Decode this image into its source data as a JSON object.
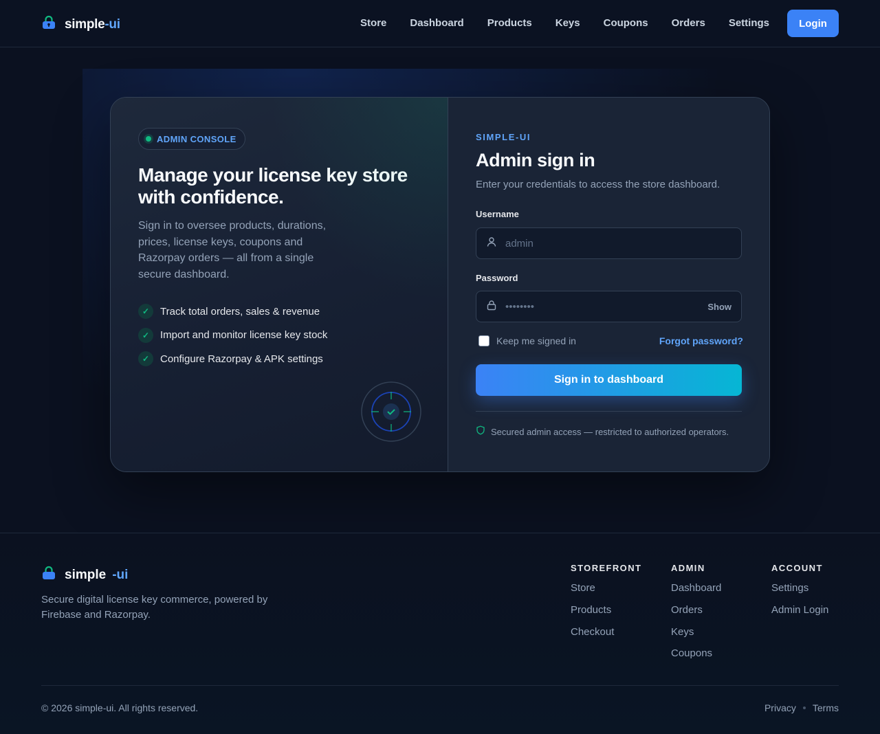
{
  "brand": {
    "name": "simple",
    "accent": "-ui",
    "logo_icon": "lock-bag-icon"
  },
  "nav": {
    "items": [
      "Store",
      "Dashboard",
      "Products",
      "Keys",
      "Coupons",
      "Orders",
      "Settings"
    ],
    "login_label": "Login"
  },
  "hero": {
    "badge": "ADMIN CONSOLE",
    "title": "Manage your license key store with confidence.",
    "subtitle": "Sign in to oversee products, durations, prices, license keys, coupons and Razorpay orders — all from a single secure dashboard.",
    "features": [
      "Track total orders, sales & revenue",
      "Import and monitor license key stock",
      "Configure Razorpay & APK settings"
    ],
    "check_glyph": "✓"
  },
  "form": {
    "eyebrow": "SIMPLE-UI",
    "title": "Admin sign in",
    "subtitle": "Enter your credentials to access the store dashboard.",
    "username_label": "Username",
    "username_placeholder": "admin",
    "password_label": "Password",
    "password_placeholder": "••••••••",
    "show_label": "Show",
    "remember_label": "Keep me signed in",
    "forgot_label": "Forgot password?",
    "submit_label": "Sign in to dashboard",
    "secure_note": "Secured admin access — restricted to authorized operators."
  },
  "footer": {
    "brand_name": "simple",
    "brand_accent": "-ui",
    "tagline": "Secure digital license key commerce, powered by Firebase and Razorpay.",
    "columns": [
      {
        "title": "STOREFRONT",
        "links": [
          "Store",
          "Products",
          "Checkout"
        ]
      },
      {
        "title": "ADMIN",
        "links": [
          "Dashboard",
          "Orders",
          "Keys",
          "Coupons"
        ]
      },
      {
        "title": "ACCOUNT",
        "links": [
          "Settings",
          "Admin Login"
        ]
      }
    ],
    "copyright": "© 2026 simple-ui. All rights reserved.",
    "legal": [
      "Privacy",
      "Terms"
    ]
  },
  "colors": {
    "accent": "#3b82f6",
    "accent_light": "#60a5fa",
    "success": "#10b981",
    "background": "#0b1120",
    "card": "#1a2436"
  }
}
